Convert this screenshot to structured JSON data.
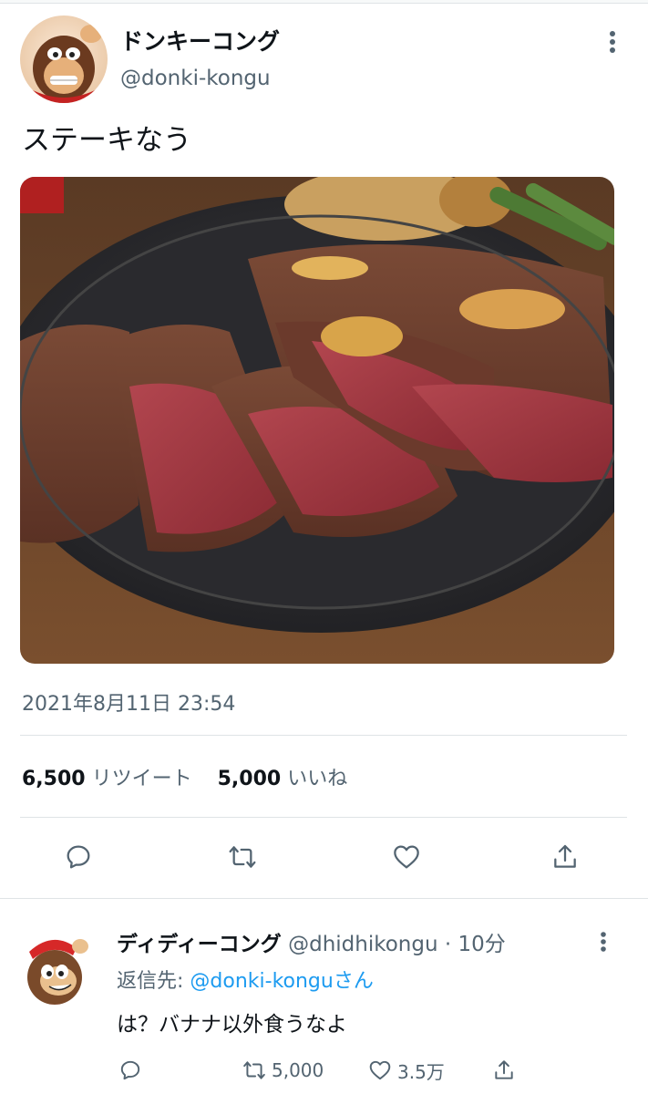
{
  "tweet": {
    "author_name": "ドンキーコング",
    "author_handle": "@donki-kongu",
    "text": "ステーキなう",
    "timestamp": "2021年8月11日 23:54",
    "retweet_count": "6,500",
    "retweet_label": "リツイート",
    "like_count": "5,000",
    "like_label": "いいね",
    "icons": [
      "more-icon",
      "reply-icon",
      "retweet-icon",
      "like-icon",
      "share-icon"
    ]
  },
  "reply": {
    "author_name": "ディディーコング",
    "meta": "@dhidhikongu · 10分",
    "reply_to_prefix": "返信先: ",
    "reply_to_mention": "@donki-konguさん",
    "text": "は？バナナ以外食うなよ",
    "retweet_count": "5,000",
    "like_count": "3.5万"
  },
  "colors": {
    "text": "#0f1419",
    "secondary": "#536471",
    "link": "#1d9bf0",
    "divider": "#dfe3e6"
  }
}
